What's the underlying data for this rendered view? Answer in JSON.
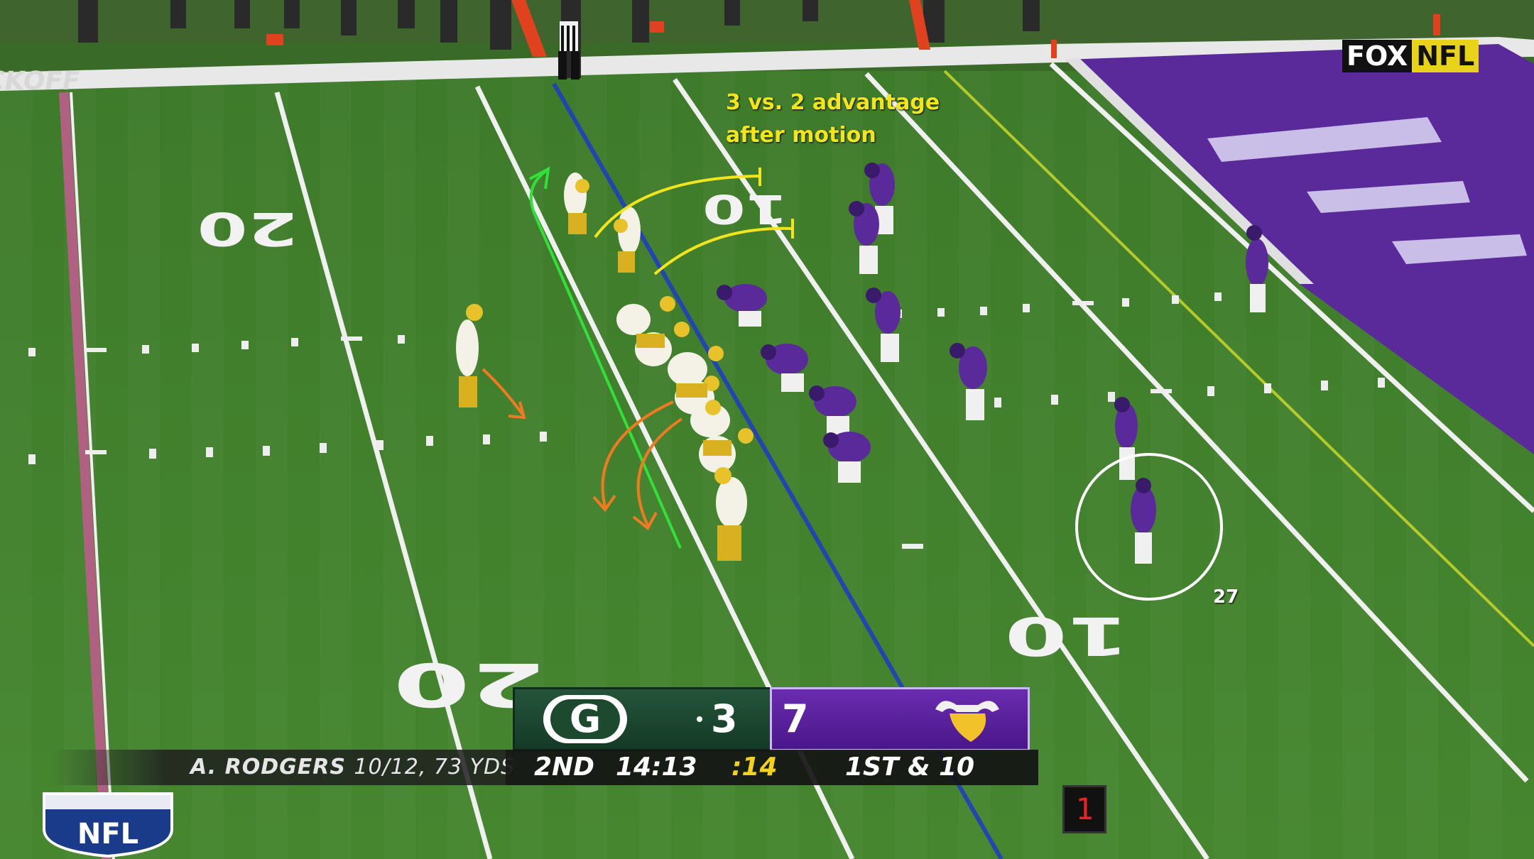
{
  "annotation": {
    "advantage_line1": "3 vs. 2 advantage",
    "advantage_line2": "after motion",
    "highlight_number": "27"
  },
  "field": {
    "endzone_text": "CKOFF",
    "yard_numbers_left": [
      "20",
      "20"
    ],
    "yard_numbers_right": [
      "10",
      "10"
    ]
  },
  "broadcast": {
    "network_fox": "FOX",
    "network_nfl": "NFL",
    "league_logo_text": "NFL",
    "down_marker": "1"
  },
  "scoreboard": {
    "home_team_logo": "G",
    "home_score": "3",
    "away_score": "7",
    "period": "2ND",
    "game_clock": "14:13",
    "play_clock": ":14",
    "down_distance": "1ST & 10",
    "player_stat_name": "A. RODGERS",
    "player_stat_line": "10/12, 73 YDS"
  },
  "colors": {
    "field_green": "#3f7a2c",
    "vikings_purple": "#5a2a9a",
    "packers_green": "#1d4a2e",
    "packers_gold": "#f2c22a",
    "annotation_yellow": "#f2e61a",
    "annotation_green": "#31e03a",
    "annotation_orange": "#f07a22"
  }
}
